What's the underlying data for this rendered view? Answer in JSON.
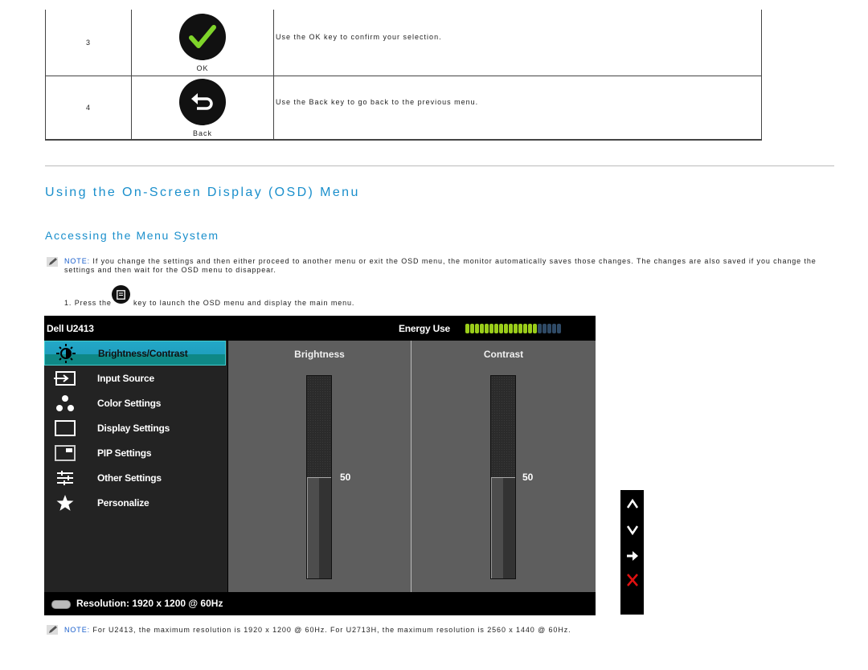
{
  "key_table": {
    "rows": [
      {
        "number": "3",
        "icon": "checkmark-icon",
        "key_label": "OK",
        "description": "Use the OK key to confirm your selection."
      },
      {
        "number": "4",
        "icon": "back-arrow-icon",
        "key_label": "Back",
        "description": "Use the Back key to go back to the previous menu."
      }
    ]
  },
  "section": {
    "title": "Using the On-Screen Display (OSD) Menu",
    "subtitle": "Accessing the Menu System"
  },
  "note1": {
    "label": "NOTE:",
    "text": " If you change the settings and then either proceed to another menu or exit the OSD menu, the monitor automatically saves those changes. The changes are also saved if you change the settings and then wait for the OSD menu to disappear."
  },
  "step1": {
    "prefix": "1. Press the",
    "suffix": "key to launch the OSD menu and display the main menu.",
    "icon": "menu-key-icon"
  },
  "osd": {
    "model": "Dell U2413",
    "energy_label": "Energy Use",
    "energy_level": {
      "filled": 15,
      "total": 20
    },
    "colors": {
      "energy_on": "#9acd1a",
      "energy_off": "#2f4a66",
      "active_item": "#1fa3c3"
    },
    "menu_items": [
      {
        "label": "Brightness/Contrast",
        "icon": "brightness-icon",
        "active": true
      },
      {
        "label": "Input Source",
        "icon": "input-source-icon",
        "active": false
      },
      {
        "label": "Color Settings",
        "icon": "color-settings-icon",
        "active": false
      },
      {
        "label": "Display Settings",
        "icon": "display-settings-icon",
        "active": false
      },
      {
        "label": "PIP Settings",
        "icon": "pip-settings-icon",
        "active": false
      },
      {
        "label": "Other Settings",
        "icon": "other-settings-icon",
        "active": false
      },
      {
        "label": "Personalize",
        "icon": "star-icon",
        "active": false
      }
    ],
    "panels": [
      {
        "title": "Brightness",
        "value": 50,
        "display": "50"
      },
      {
        "title": "Contrast",
        "value": 50,
        "display": "50"
      }
    ],
    "status": "Resolution: 1920 x 1200 @ 60Hz",
    "nav_buttons": [
      {
        "name": "up",
        "icon": "chevron-up-icon"
      },
      {
        "name": "down",
        "icon": "chevron-down-icon"
      },
      {
        "name": "enter",
        "icon": "arrow-right-icon"
      },
      {
        "name": "exit",
        "icon": "close-icon"
      }
    ]
  },
  "note2": {
    "label": "NOTE:",
    "text": " For U2413, the maximum resolution is 1920 x 1200 @ 60Hz. For U2713H, the maximum resolution is 2560 x 1440 @ 60Hz."
  }
}
